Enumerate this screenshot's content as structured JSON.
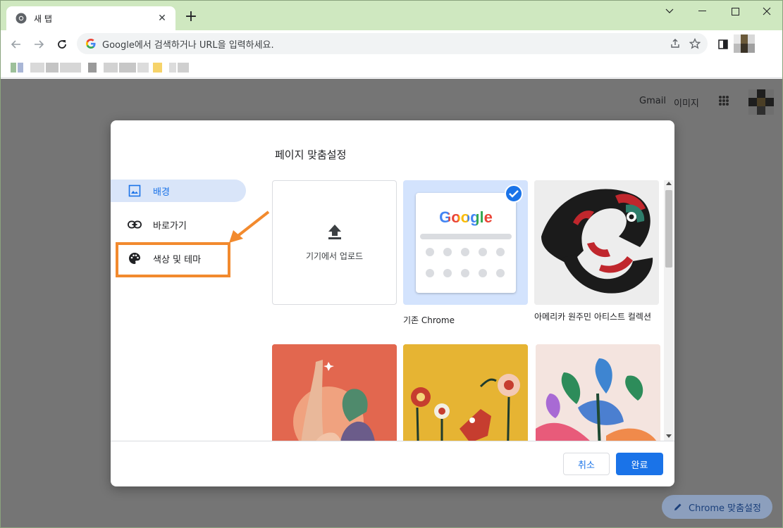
{
  "browser": {
    "tab_title": "새 탭",
    "omnibox_placeholder": "Google에서 검색하거나 URL을 입력하세요.",
    "icons": [
      "chrome-icon",
      "close-icon",
      "plus-icon",
      "chevron-down-icon",
      "minimize-icon",
      "maximize-icon",
      "window-close-icon",
      "back-icon",
      "forward-icon",
      "reload-icon",
      "google-g-icon",
      "share-icon",
      "star-icon",
      "side-panel-icon"
    ]
  },
  "ntp": {
    "gmail_link": "Gmail",
    "images_link": "이미지",
    "customize_chrome": "Chrome 맞춤설정"
  },
  "dialog": {
    "title": "페이지 맞춤설정",
    "sidebar": [
      {
        "label": "배경",
        "icon": "image-icon",
        "active": true
      },
      {
        "label": "바로가기",
        "icon": "link-icon",
        "active": false
      },
      {
        "label": "색상 및 테마",
        "icon": "palette-icon",
        "active": false
      }
    ],
    "tiles": [
      {
        "label": "기기에서 업로드",
        "kind": "upload"
      },
      {
        "label": "기존 Chrome",
        "kind": "chrome",
        "selected": true
      },
      {
        "label": "아메리카 원주민 아티스트 컬렉션",
        "kind": "image"
      }
    ],
    "chrome_tile_logo": "Google",
    "cancel": "취소",
    "done": "완료"
  },
  "colors": {
    "accent": "#1a73e8",
    "tab_strip": "#cfe8c0",
    "highlight": "#f28a2e",
    "active_item_bg": "#d9e5f9"
  }
}
